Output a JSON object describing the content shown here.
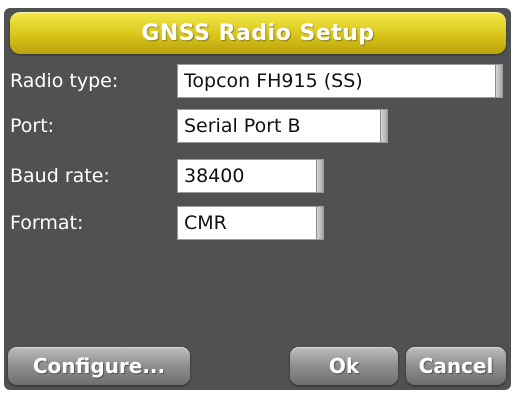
{
  "dialog": {
    "title": "GNSS Radio Setup"
  },
  "fields": [
    {
      "label": "Radio type:",
      "value": "Topcon FH915 (SS)"
    },
    {
      "label": "Port:",
      "value": "Serial Port B"
    },
    {
      "label": "Baud rate:",
      "value": "38400"
    },
    {
      "label": "Format:",
      "value": "CMR"
    }
  ],
  "buttons": {
    "configure": "Configure...",
    "ok": "Ok",
    "cancel": "Cancel"
  },
  "colors": {
    "title_bar": "#d9c51a",
    "dialog_background": "#4f5152",
    "button": "#8e8e8e"
  }
}
